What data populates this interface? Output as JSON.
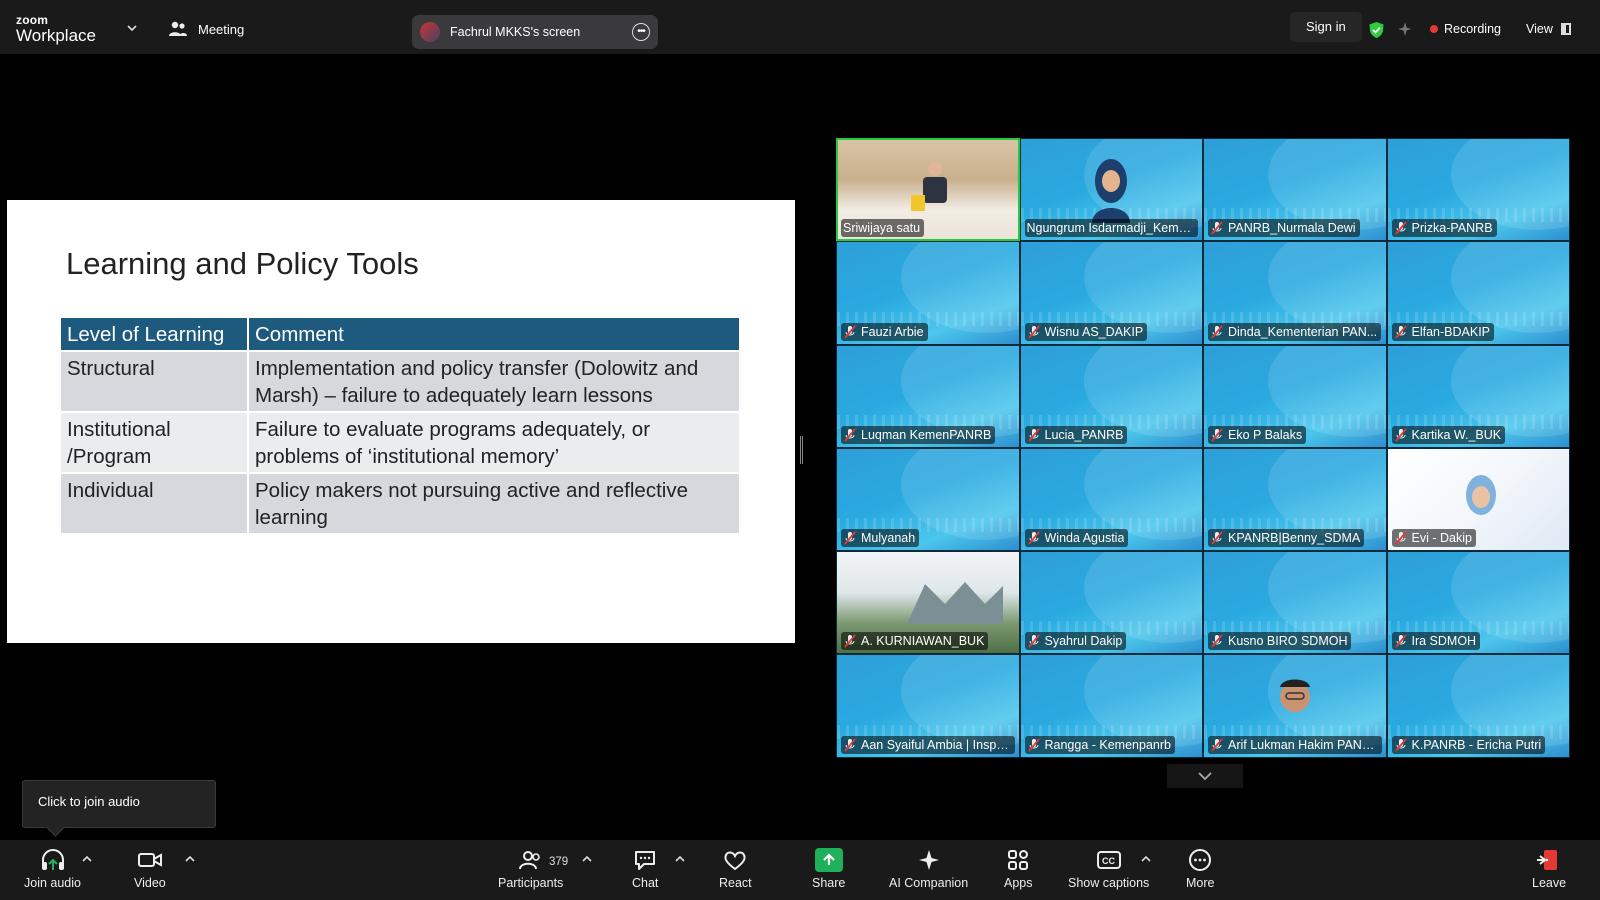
{
  "topbar": {
    "logo_small": "zoom",
    "logo_big": "Workplace",
    "meeting_label": "Meeting",
    "screen_share_label": "Fachrul MKKS's screen",
    "signin_label": "Sign in",
    "recording_label": "Recording",
    "view_label": "View"
  },
  "slide": {
    "title": "Learning and Policy Tools",
    "headers": [
      "Level of Learning",
      "Comment"
    ],
    "rows": [
      {
        "level": "Structural",
        "comment": "Implementation and policy transfer (Dolowitz and Marsh) – failure to adequately learn lessons"
      },
      {
        "level": "Institutional /Program",
        "comment": "Failure to evaluate programs adequately, or problems of ‘institutional memory’"
      },
      {
        "level": "Individual",
        "comment": "Policy makers not pursuing active and reflective learning"
      }
    ]
  },
  "participants": [
    {
      "name": "Sriwijaya satu"
    },
    {
      "name": "Ngungrum Isdarmadji_Keme..."
    },
    {
      "name": "PANRB_Nurmala Dewi"
    },
    {
      "name": "Prizka-PANRB"
    },
    {
      "name": "Fauzi Arbie"
    },
    {
      "name": "Wisnu AS_DAKIP"
    },
    {
      "name": "Dinda_Kementerian PAN..."
    },
    {
      "name": "Elfan-BDAKIP"
    },
    {
      "name": "Luqman KemenPANRB"
    },
    {
      "name": "Lucia_PANRB"
    },
    {
      "name": "Eko P Balaks"
    },
    {
      "name": "Kartika W._BUK"
    },
    {
      "name": "Mulyanah"
    },
    {
      "name": "Winda Agustia"
    },
    {
      "name": "KPANRB|Benny_SDMA"
    },
    {
      "name": "Evi - Dakip"
    },
    {
      "name": "A. KURNIAWAN_BUK"
    },
    {
      "name": "Syahrul Dakip"
    },
    {
      "name": "Kusno BIRO SDMOH"
    },
    {
      "name": "Ira SDMOH"
    },
    {
      "name": "Aan Syaiful Ambia | Inspe..."
    },
    {
      "name": "Rangga - Kemenpanrb"
    },
    {
      "name": "Arif Lukman Hakim PANRB"
    },
    {
      "name": "K.PANRB - Ericha Putri"
    }
  ],
  "tooltip": {
    "join_audio": "Click to join audio"
  },
  "toolbar": {
    "join_audio": "Join audio",
    "video": "Video",
    "participants": "Participants",
    "participant_count": "379",
    "chat": "Chat",
    "react": "React",
    "share": "Share",
    "ai_companion": "AI Companion",
    "apps": "Apps",
    "show_captions": "Show captions",
    "more": "More",
    "leave": "Leave"
  },
  "colors": {
    "table_header": "#1d5a7e",
    "share_green": "#1fb15a",
    "recording_red": "#e53935",
    "active_speaker": "#27c93f"
  }
}
